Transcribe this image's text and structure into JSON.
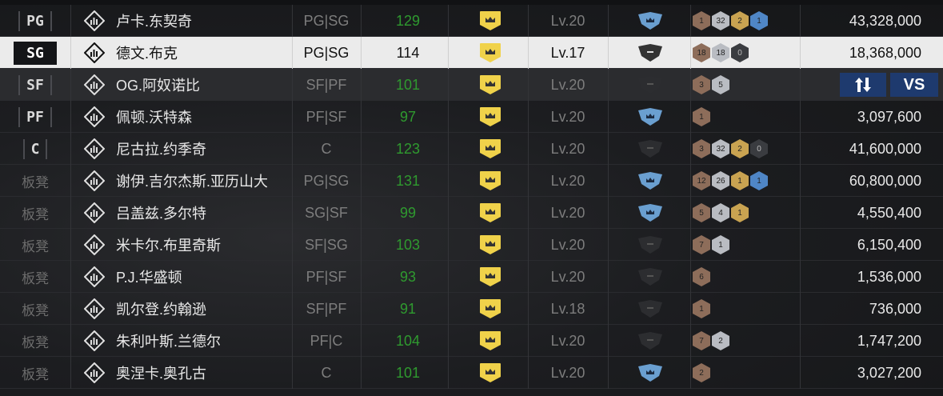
{
  "roster": [
    {
      "slot": "PG",
      "bench": false,
      "name": "卢卡.东契奇",
      "positions": "PG|SG",
      "ovr": "129",
      "level": "Lv.20",
      "badge": "blue",
      "chips": [
        [
          "bronze",
          "1"
        ],
        [
          "silver",
          "32"
        ],
        [
          "gold",
          "2"
        ],
        [
          "blue",
          "1"
        ]
      ],
      "salary": "43,328,000"
    },
    {
      "slot": "SG",
      "bench": false,
      "name": "德文.布克",
      "positions": "PG|SG",
      "ovr": "114",
      "level": "Lv.17",
      "badge": "dark",
      "chips": [
        [
          "bronze",
          "18"
        ],
        [
          "silver",
          "18"
        ],
        [
          "dark",
          "0"
        ]
      ],
      "salary": "18,368,000",
      "selected": true
    },
    {
      "slot": "SF",
      "bench": false,
      "name": "OG.阿奴诺比",
      "positions": "SF|PF",
      "ovr": "101",
      "level": "Lv.20",
      "badge": "dark",
      "chips": [
        [
          "bronze",
          "3"
        ],
        [
          "silver",
          "5"
        ]
      ],
      "salary": "",
      "alt": true
    },
    {
      "slot": "PF",
      "bench": false,
      "name": "佩顿.沃特森",
      "positions": "PF|SF",
      "ovr": "97",
      "level": "Lv.20",
      "badge": "blue",
      "chips": [
        [
          "bronze",
          "1"
        ]
      ],
      "salary": "3,097,600"
    },
    {
      "slot": "C",
      "bench": false,
      "name": "尼古拉.约季奇",
      "positions": "C",
      "ovr": "123",
      "level": "Lv.20",
      "badge": "dark",
      "chips": [
        [
          "bronze",
          "3"
        ],
        [
          "silver",
          "32"
        ],
        [
          "gold",
          "2"
        ],
        [
          "dark",
          "0"
        ]
      ],
      "salary": "41,600,000"
    },
    {
      "slot": "板凳",
      "bench": true,
      "name": "谢伊.吉尔杰斯.亚历山大",
      "positions": "PG|SG",
      "ovr": "131",
      "level": "Lv.20",
      "badge": "blue",
      "chips": [
        [
          "bronze",
          "12"
        ],
        [
          "silver",
          "26"
        ],
        [
          "gold",
          "1"
        ],
        [
          "blue",
          "1"
        ]
      ],
      "salary": "60,800,000"
    },
    {
      "slot": "板凳",
      "bench": true,
      "name": "吕盖兹.多尔特",
      "positions": "SG|SF",
      "ovr": "99",
      "level": "Lv.20",
      "badge": "blue",
      "chips": [
        [
          "bronze",
          "5"
        ],
        [
          "silver",
          "4"
        ],
        [
          "gold",
          "1"
        ]
      ],
      "salary": "4,550,400"
    },
    {
      "slot": "板凳",
      "bench": true,
      "name": "米卡尔.布里奇斯",
      "positions": "SF|SG",
      "ovr": "103",
      "level": "Lv.20",
      "badge": "dark",
      "chips": [
        [
          "bronze",
          "7"
        ],
        [
          "silver",
          "1"
        ]
      ],
      "salary": "6,150,400"
    },
    {
      "slot": "板凳",
      "bench": true,
      "name": "P.J.华盛顿",
      "positions": "PF|SF",
      "ovr": "93",
      "level": "Lv.20",
      "badge": "dark",
      "chips": [
        [
          "bronze",
          "6"
        ]
      ],
      "salary": "1,536,000"
    },
    {
      "slot": "板凳",
      "bench": true,
      "name": "凯尔登.约翰逊",
      "positions": "SF|PF",
      "ovr": "91",
      "level": "Lv.18",
      "badge": "dark",
      "chips": [
        [
          "bronze",
          "1"
        ]
      ],
      "salary": "736,000"
    },
    {
      "slot": "板凳",
      "bench": true,
      "name": "朱利叶斯.兰德尔",
      "positions": "PF|C",
      "ovr": "104",
      "level": "Lv.20",
      "badge": "dark",
      "chips": [
        [
          "bronze",
          "7"
        ],
        [
          "silver",
          "2"
        ]
      ],
      "salary": "1,747,200"
    },
    {
      "slot": "板凳",
      "bench": true,
      "name": "奥涅卡.奥孔古",
      "positions": "C",
      "ovr": "101",
      "level": "Lv.20",
      "badge": "blue",
      "chips": [
        [
          "bronze",
          "2"
        ]
      ],
      "salary": "3,027,200"
    }
  ],
  "buttons": {
    "swap_icon": "swap-arrows-icon",
    "vs_label": "VS"
  },
  "colors": {
    "ovr_green": "#2f9a2f",
    "crown_yellow": "#f0d24a",
    "badge_blue": "#6a9fd0",
    "button_blue": "#1e3a6e"
  }
}
